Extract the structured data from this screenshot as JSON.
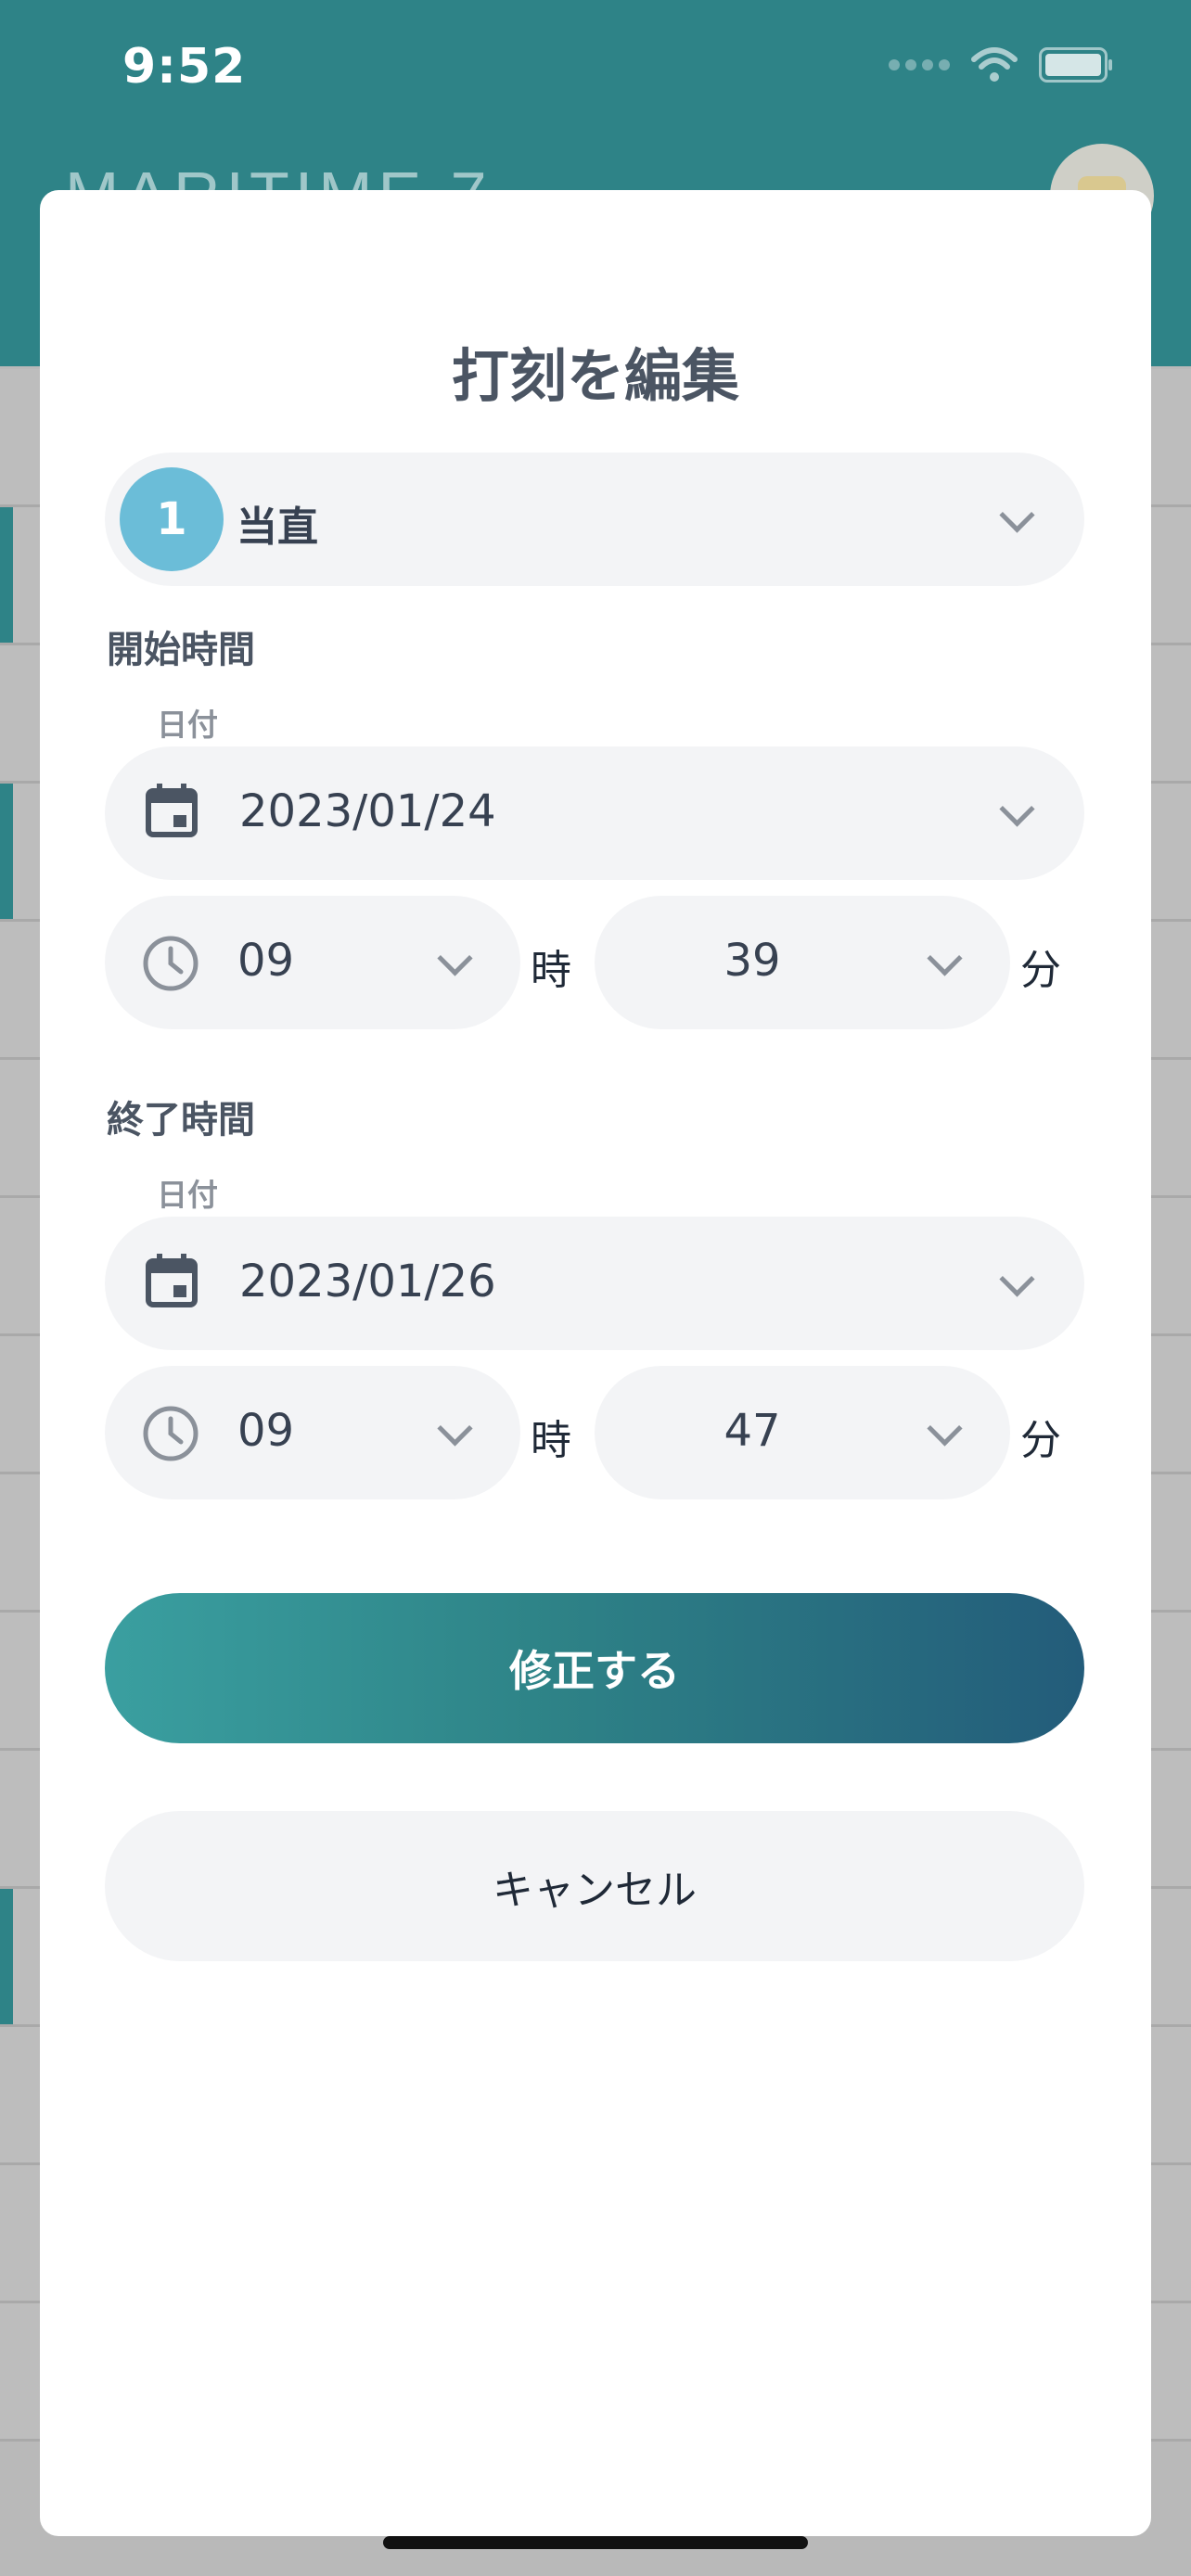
{
  "status_bar": {
    "time": "9:52"
  },
  "app": {
    "title": "MARITIME 7"
  },
  "modal": {
    "title": "打刻を編集",
    "type_select": {
      "badge": "1",
      "label": "当直"
    },
    "start": {
      "section_label": "開始時間",
      "date_caption": "日付",
      "date": "2023/01/24",
      "hour": "09",
      "hour_unit": "時",
      "minute": "39",
      "minute_unit": "分"
    },
    "end": {
      "section_label": "終了時間",
      "date_caption": "日付",
      "date": "2023/01/26",
      "hour": "09",
      "hour_unit": "時",
      "minute": "47",
      "minute_unit": "分"
    },
    "submit_label": "修正する",
    "cancel_label": "キャンセル"
  },
  "colors": {
    "header": "#2e8387",
    "badge": "#6bbdd8",
    "button_gradient_start": "#3a9fa0",
    "button_gradient_end": "#235c7a"
  },
  "icons": [
    "wifi-icon",
    "battery-icon",
    "avatar",
    "chevron-down-icon",
    "calendar-icon",
    "clock-icon"
  ]
}
